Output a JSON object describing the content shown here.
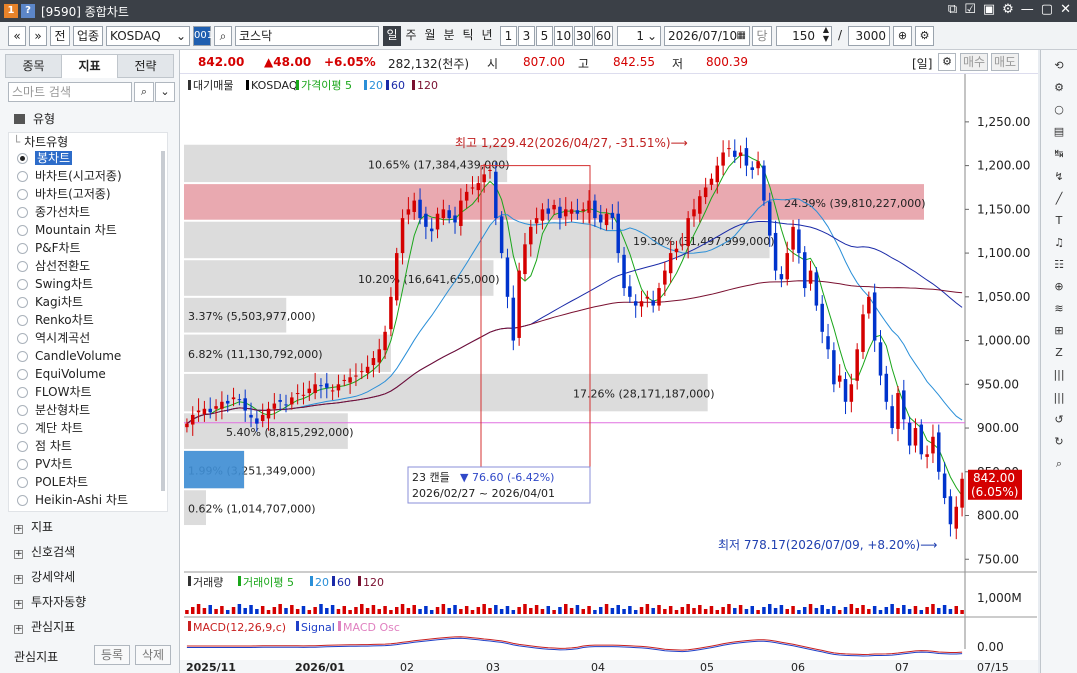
{
  "window": {
    "badge1": "1",
    "badge2": "?",
    "title": "[9590] 종합차트",
    "controls": [
      "⧉",
      "☑",
      "▣",
      "⚙",
      "—",
      "▢",
      "✕"
    ]
  },
  "toolbar": {
    "nav_first": "«",
    "nav_next": "»",
    "btn_jeon": "전",
    "btn_industry": "업종",
    "market_select": "KOSDAQ",
    "code": "001",
    "search_icon": "⌕",
    "name": "코스닥",
    "periods": [
      "일",
      "주",
      "월",
      "분",
      "틱",
      "년"
    ],
    "active_period": "일",
    "intervals": [
      "1",
      "3",
      "5",
      "10",
      "30",
      "60"
    ],
    "interval_value": "1",
    "date": "2026/07/10",
    "btn_dang": "당",
    "count": "150",
    "slash": "/",
    "total": "3000"
  },
  "left_panel": {
    "tabs": [
      "종목",
      "지표",
      "전략"
    ],
    "active_tab": "지표",
    "search_placeholder": "스마트 검색",
    "section_type": "유형",
    "chart_type_label": "차트유형",
    "chart_types": [
      "봉차트",
      "바차트(시고저종)",
      "바차트(고저종)",
      "종가선차트",
      "Mountain 차트",
      "P&F차트",
      "삼선전환도",
      "Swing차트",
      "Kagi차트",
      "Renko차트",
      "역시계곡선",
      "CandleVolume",
      "EquiVolume",
      "FLOW차트",
      "분산형차트",
      "계단 차트",
      "점 차트",
      "PV차트",
      "POLE차트",
      "Heikin-Ashi 차트"
    ],
    "selected_type": "봉차트",
    "groups": [
      "지표",
      "신호검색",
      "강세약세",
      "투자자동향",
      "관심지표"
    ],
    "bottom_label": "관심지표",
    "btn_register": "등록",
    "btn_delete": "삭제"
  },
  "price_bar": {
    "price": "842.00",
    "change": "▲48.00",
    "change_pct": "+6.05%",
    "volume": "282,132(천주)",
    "open_label": "시",
    "open": "807.00",
    "high_label": "고",
    "high": "842.55",
    "low_label": "저",
    "low": "800.39",
    "period_tag": "[일]",
    "btn_buy": "매수",
    "btn_sell": "매도"
  },
  "colors": {
    "up": "#d40000",
    "down": "#0033cc",
    "ma5": "#1aa61a",
    "ma20": "#2a8fd8",
    "ma60": "#1a2aa8",
    "ma120": "#7a1030"
  },
  "legend_main": [
    "대기매물",
    "KOSDAQ",
    "가격이평 5",
    "20",
    "60",
    "120"
  ],
  "legend_volume": [
    "거래량",
    "거래이평 5",
    "20",
    "60",
    "120"
  ],
  "legend_macd": [
    "MACD(12,26,9,c)",
    "Signal",
    "MACD Osc"
  ],
  "annotations": {
    "high_note": "최고 1,229.42(2026/04/27, -31.51%)",
    "low_note": "최저 778.17(2026/07/09, +8.20%)",
    "range_count": "23 캔들",
    "range_change": "▼ 76.60 (-6.42%)",
    "range_dates": "2026/02/27 ~ 2026/04/01"
  },
  "current_price_tag": {
    "price": "842.00",
    "pct": "(6.05%)"
  },
  "volume_axis_label": "1,000M",
  "macd_axis_label": "0.00",
  "last_date_label": "07/15",
  "chart_data": {
    "type": "candlestick",
    "ylim": [
      740,
      1275
    ],
    "y_ticks": [
      750,
      800,
      850,
      900,
      950,
      1000,
      1050,
      1100,
      1150,
      1200,
      1250
    ],
    "x_tick_labels": [
      "2025/11",
      "2026/01",
      "02",
      "03",
      "04",
      "05",
      "06",
      "07"
    ],
    "reference_line": 906,
    "volume_profile": [
      {
        "low": 1180,
        "high": 1225,
        "pct": "10.65%",
        "vol": "17,384,439,000"
      },
      {
        "low": 1137,
        "high": 1180,
        "pct": "24.39%",
        "vol": "39,810,227,000",
        "highlight": true
      },
      {
        "low": 1093,
        "high": 1137,
        "pct": "19.30%",
        "vol": "31,497,999,000"
      },
      {
        "low": 1050,
        "high": 1093,
        "pct": "10.20%",
        "vol": "16,641,655,000"
      },
      {
        "low": 1008,
        "high": 1050,
        "pct": "3.37%",
        "vol": "5,503,977,000"
      },
      {
        "low": 963,
        "high": 1008,
        "pct": "6.82%",
        "vol": "11,130,792,000"
      },
      {
        "low": 918,
        "high": 963,
        "pct": "17.26%",
        "vol": "28,171,187,000"
      },
      {
        "low": 875,
        "high": 918,
        "pct": "5.40%",
        "vol": "8,815,292,000"
      },
      {
        "low": 830,
        "high": 875,
        "pct": "1.99%",
        "vol": "3,251,349,000"
      },
      {
        "low": 788,
        "high": 830,
        "pct": "0.62%",
        "vol": "1,014,707,000"
      }
    ],
    "close": [
      905,
      915,
      920,
      922,
      918,
      925,
      930,
      928,
      935,
      932,
      920,
      912,
      905,
      915,
      922,
      928,
      930,
      926,
      935,
      940,
      938,
      945,
      950,
      948,
      946,
      943,
      950,
      955,
      958,
      960,
      965,
      970,
      980,
      990,
      1010,
      1050,
      1100,
      1140,
      1150,
      1160,
      1140,
      1130,
      1125,
      1145,
      1150,
      1140,
      1135,
      1160,
      1170,
      1175,
      1180,
      1190,
      1195,
      1140,
      1100,
      1050,
      1000,
      1080,
      1110,
      1130,
      1140,
      1150,
      1145,
      1155,
      1140,
      1150,
      1150,
      1145,
      1150,
      1160,
      1140,
      1135,
      1145,
      1140,
      1100,
      1060,
      1050,
      1040,
      1045,
      1050,
      1040,
      1060,
      1080,
      1100,
      1105,
      1110,
      1140,
      1150,
      1165,
      1175,
      1185,
      1200,
      1215,
      1220,
      1210,
      1215,
      1200,
      1195,
      1205,
      1160,
      1120,
      1080,
      1070,
      1100,
      1130,
      1100,
      1060,
      1080,
      1040,
      1010,
      990,
      950,
      960,
      930,
      950,
      990,
      1030,
      1050,
      1000,
      960,
      930,
      900,
      940,
      910,
      880,
      900,
      870,
      870,
      890,
      850,
      820,
      790,
      810,
      842
    ]
  },
  "right_tools": [
    "⟲",
    "⚙",
    "○",
    "▤",
    "↹",
    "↯",
    "╱",
    "T",
    "♫",
    "☷",
    "⊕",
    "≋",
    "⊞",
    "Z",
    "|||",
    "|||",
    "↺",
    "↻",
    "⌕"
  ]
}
